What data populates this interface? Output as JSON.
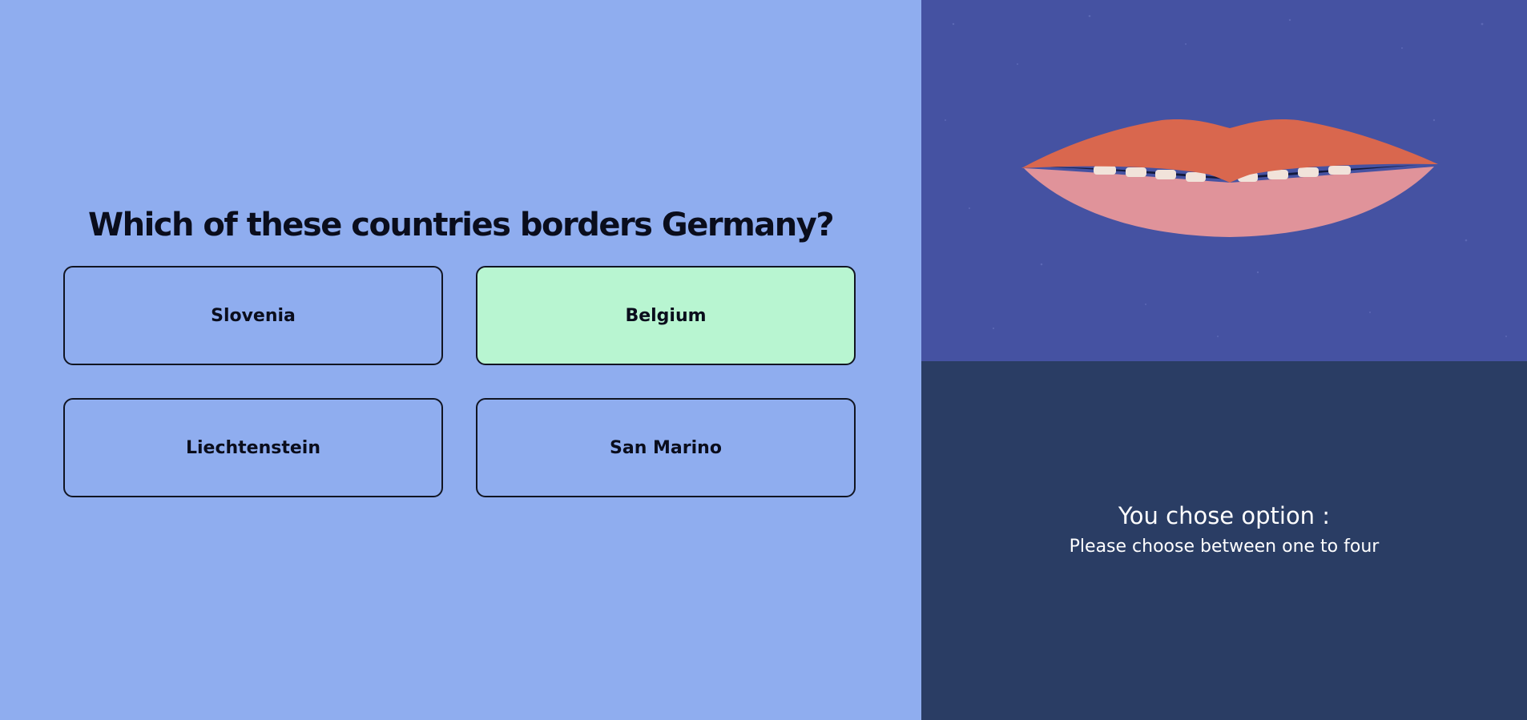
{
  "question": {
    "text": "Which of these countries borders Germany?"
  },
  "options": [
    {
      "label": "Slovenia",
      "selected": false
    },
    {
      "label": "Belgium",
      "selected": true
    },
    {
      "label": "Liechtenstein",
      "selected": false
    },
    {
      "label": "San Marino",
      "selected": false
    }
  ],
  "feedback": {
    "title": "You chose option :",
    "subtitle": "Please choose between one to four"
  },
  "colors": {
    "quiz_background": "#8fadef",
    "selected_option": "#b8f5d1",
    "illustration_background": "#4552a2",
    "feedback_background": "#2a3d64",
    "upper_lip": "#d9674e",
    "lower_lip": "#e0939a"
  },
  "illustration": {
    "icon": "lips-icon"
  }
}
